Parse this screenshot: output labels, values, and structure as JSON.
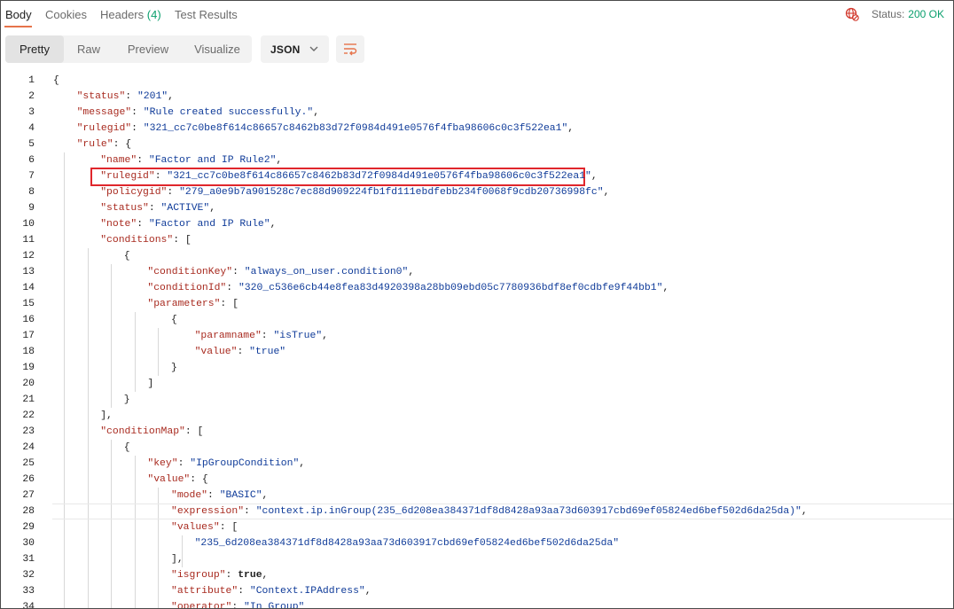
{
  "tabs": {
    "body": "Body",
    "cookies": "Cookies",
    "headers": "Headers",
    "headers_count": "(4)",
    "test_results": "Test Results"
  },
  "status": {
    "label": "Status:",
    "value": "200 OK"
  },
  "toolbar": {
    "pretty": "Pretty",
    "raw": "Raw",
    "preview": "Preview",
    "visualize": "Visualize",
    "format": "JSON"
  },
  "colors": {
    "accent": "#e6734a",
    "status_ok": "#0ca06e",
    "json_key": "#a82a1f",
    "json_string": "#0f3b99",
    "highlight_box": "#e0262c"
  },
  "code": {
    "lines": [
      [
        [
          "p",
          "{"
        ]
      ],
      [
        [
          "k",
          "\"status\""
        ],
        [
          "p",
          ": "
        ],
        [
          "s",
          "\"201\""
        ],
        [
          "p",
          ","
        ]
      ],
      [
        [
          "k",
          "\"message\""
        ],
        [
          "p",
          ": "
        ],
        [
          "s",
          "\"Rule created successfully.\""
        ],
        [
          "p",
          ","
        ]
      ],
      [
        [
          "k",
          "\"rulegid\""
        ],
        [
          "p",
          ": "
        ],
        [
          "s",
          "\"321_cc7c0be8f614c86657c8462b83d72f0984d491e0576f4fba98606c0c3f522ea1\""
        ],
        [
          "p",
          ","
        ]
      ],
      [
        [
          "k",
          "\"rule\""
        ],
        [
          "p",
          ": {"
        ]
      ],
      [
        [
          "k",
          "\"name\""
        ],
        [
          "p",
          ": "
        ],
        [
          "s",
          "\"Factor and IP Rule2\""
        ],
        [
          "p",
          ","
        ]
      ],
      [
        [
          "k",
          "\"rulegid\""
        ],
        [
          "p",
          ": "
        ],
        [
          "s",
          "\"321_cc7c0be8f614c86657c8462b83d72f0984d491e0576f4fba98606c0c3f522ea1\""
        ],
        [
          "p",
          ","
        ]
      ],
      [
        [
          "k",
          "\"policygid\""
        ],
        [
          "p",
          ": "
        ],
        [
          "s",
          "\"279_a0e9b7a901528c7ec88d909224fb1fd111ebdfebb234f0068f9cdb20736998fc\""
        ],
        [
          "p",
          ","
        ]
      ],
      [
        [
          "k",
          "\"status\""
        ],
        [
          "p",
          ": "
        ],
        [
          "s",
          "\"ACTIVE\""
        ],
        [
          "p",
          ","
        ]
      ],
      [
        [
          "k",
          "\"note\""
        ],
        [
          "p",
          ": "
        ],
        [
          "s",
          "\"Factor and IP Rule\""
        ],
        [
          "p",
          ","
        ]
      ],
      [
        [
          "k",
          "\"conditions\""
        ],
        [
          "p",
          ": ["
        ]
      ],
      [
        [
          "p",
          "{"
        ]
      ],
      [
        [
          "k",
          "\"conditionKey\""
        ],
        [
          "p",
          ": "
        ],
        [
          "s",
          "\"always_on_user.condition0\""
        ],
        [
          "p",
          ","
        ]
      ],
      [
        [
          "k",
          "\"conditionId\""
        ],
        [
          "p",
          ": "
        ],
        [
          "s",
          "\"320_c536e6cb44e8fea83d4920398a28bb09ebd05c7780936bdf8ef0cdbfe9f44bb1\""
        ],
        [
          "p",
          ","
        ]
      ],
      [
        [
          "k",
          "\"parameters\""
        ],
        [
          "p",
          ": ["
        ]
      ],
      [
        [
          "p",
          "{"
        ]
      ],
      [
        [
          "k",
          "\"paramname\""
        ],
        [
          "p",
          ": "
        ],
        [
          "s",
          "\"isTrue\""
        ],
        [
          "p",
          ","
        ]
      ],
      [
        [
          "k",
          "\"value\""
        ],
        [
          "p",
          ": "
        ],
        [
          "s",
          "\"true\""
        ]
      ],
      [
        [
          "p",
          "}"
        ]
      ],
      [
        [
          "p",
          "]"
        ]
      ],
      [
        [
          "p",
          "}"
        ]
      ],
      [
        [
          "p",
          "],"
        ]
      ],
      [
        [
          "k",
          "\"conditionMap\""
        ],
        [
          "p",
          ": ["
        ]
      ],
      [
        [
          "p",
          "{"
        ]
      ],
      [
        [
          "k",
          "\"key\""
        ],
        [
          "p",
          ": "
        ],
        [
          "s",
          "\"IpGroupCondition\""
        ],
        [
          "p",
          ","
        ]
      ],
      [
        [
          "k",
          "\"value\""
        ],
        [
          "p",
          ": {"
        ]
      ],
      [
        [
          "k",
          "\"mode\""
        ],
        [
          "p",
          ": "
        ],
        [
          "s",
          "\"BASIC\""
        ],
        [
          "p",
          ","
        ]
      ],
      [
        [
          "k",
          "\"expression\""
        ],
        [
          "p",
          ": "
        ],
        [
          "s",
          "\"context.ip.inGroup(235_6d208ea384371df8d8428a93aa73d603917cbd69ef05824ed6bef502d6da25da)\""
        ],
        [
          "p",
          ","
        ]
      ],
      [
        [
          "k",
          "\"values\""
        ],
        [
          "p",
          ": ["
        ]
      ],
      [
        [
          "s",
          "\"235_6d208ea384371df8d8428a93aa73d603917cbd69ef05824ed6bef502d6da25da\""
        ]
      ],
      [
        [
          "p",
          "],"
        ]
      ],
      [
        [
          "k",
          "\"isgroup\""
        ],
        [
          "p",
          ": "
        ],
        [
          "b",
          "true"
        ],
        [
          "p",
          ","
        ]
      ],
      [
        [
          "k",
          "\"attribute\""
        ],
        [
          "p",
          ": "
        ],
        [
          "s",
          "\"Context.IPAddress\""
        ],
        [
          "p",
          ","
        ]
      ],
      [
        [
          "k",
          "\"operator\""
        ],
        [
          "p",
          ": "
        ],
        [
          "s",
          "\"In Group\""
        ]
      ]
    ]
  }
}
